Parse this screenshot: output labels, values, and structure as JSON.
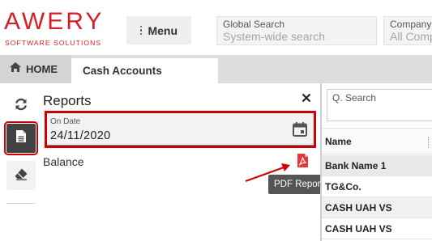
{
  "brand": {
    "name": "AWERY",
    "tagline": "SOFTWARE SOLUTIONS",
    "color": "#d32027"
  },
  "header": {
    "menu_label": "Menu",
    "global_search": {
      "label": "Global Search",
      "placeholder": "System-wide search"
    },
    "company": {
      "label": "Company",
      "placeholder": "All Comp"
    }
  },
  "tabs": [
    {
      "label": "HOME",
      "icon": "home-icon"
    },
    {
      "label": "Cash Accounts"
    }
  ],
  "toolbar": {
    "items": [
      {
        "icon": "refresh-icon"
      },
      {
        "icon": "report-icon",
        "active": true
      },
      {
        "icon": "eraser-icon"
      }
    ]
  },
  "reports_panel": {
    "title": "Reports",
    "close_icon": "close-icon",
    "on_date": {
      "label": "On Date",
      "value": "24/11/2020",
      "icon": "calendar-icon"
    },
    "items": [
      {
        "label": "Balance",
        "action_icon": "pdf-icon",
        "tooltip": "PDF Report"
      }
    ]
  },
  "list_panel": {
    "search_placeholder": "Q. Search",
    "column_header": "Name",
    "rows": [
      "Bank Name 1",
      "TG&Co.",
      "CASH UAH VS",
      "CASH UAH VS"
    ]
  },
  "colors": {
    "highlight_red": "#d00000",
    "active_tool_bg": "#424242",
    "pdf_red": "#e53935"
  }
}
